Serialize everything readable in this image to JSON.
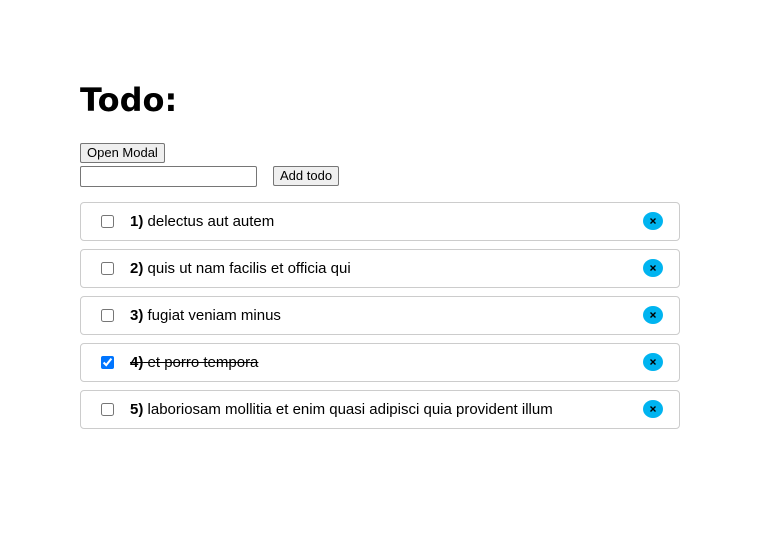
{
  "header": {
    "title": "Todo:"
  },
  "controls": {
    "open_modal_label": "Open Modal",
    "input_value": "",
    "input_placeholder": "",
    "add_todo_label": "Add todo"
  },
  "todos": [
    {
      "number": "1)",
      "text": "delectus aut autem",
      "completed": false
    },
    {
      "number": "2)",
      "text": "quis ut nam facilis et officia qui",
      "completed": false
    },
    {
      "number": "3)",
      "text": "fugiat veniam minus",
      "completed": false
    },
    {
      "number": "4)",
      "text": "et porro tempora",
      "completed": true
    },
    {
      "number": "5)",
      "text": "laboriosam mollitia et enim quasi adipisci quia provident illum",
      "completed": false
    }
  ],
  "icons": {
    "delete": "close-icon"
  },
  "colors": {
    "delete_button": "#00b4f0",
    "checkbox_checked": "#0075ff"
  }
}
